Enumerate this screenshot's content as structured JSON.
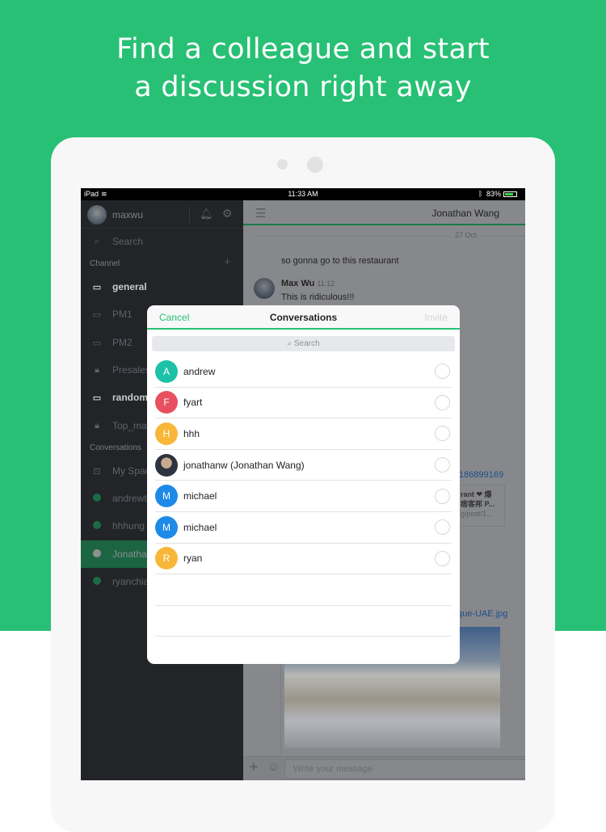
{
  "headline": {
    "line1": "Find a colleague and start",
    "line2": "a discussion right away"
  },
  "colors": {
    "brand": "#27c074"
  },
  "status_bar": {
    "device": "iPad",
    "time": "11:33 AM",
    "battery": "83%"
  },
  "sidebar": {
    "username": "maxwu",
    "search_placeholder": "Search",
    "channel_header": "Channel",
    "conversations_header": "Conversations",
    "channels": [
      {
        "label": "general",
        "icon": "chat-bubble-icon",
        "bold": true
      },
      {
        "label": "PM1",
        "icon": "chat-bubble-icon"
      },
      {
        "label": "PM2",
        "icon": "chat-bubble-icon"
      },
      {
        "label": "Presales",
        "icon": "lock-icon"
      },
      {
        "label": "random",
        "icon": "chat-bubble-icon",
        "bold": true
      },
      {
        "label": "Top_mar",
        "icon": "lock-icon"
      }
    ],
    "conversations": [
      {
        "label": "My Spac",
        "icon": "inbox-icon"
      },
      {
        "label": "andrewt",
        "icon": "online-dot"
      },
      {
        "label": "hhhung",
        "icon": "online-dot"
      },
      {
        "label": "Jonatha",
        "icon": "offline-dot",
        "selected": true
      },
      {
        "label": "ryanchia",
        "icon": "online-dot"
      }
    ]
  },
  "chat": {
    "title": "Jonathan Wang",
    "date_divider": "27 Oct",
    "message1": "so gonna go to this restaurant",
    "sender": "Max Wu",
    "sender_time": "11:12",
    "message2": "This is ridiculous!!!",
    "link_fragment": "186899169",
    "card_title_line1": "rant ❤ 爆",
    "card_title_line2": "痞客邦 P...",
    "card_url": "g/post/1...",
    "image_link": "que-UAE.jpg",
    "input_placeholder": "Write your message"
  },
  "modal": {
    "cancel": "Cancel",
    "title": "Conversations",
    "invite": "Invite",
    "search_placeholder": "Search",
    "contacts": [
      {
        "initial": "A",
        "name": "andrew",
        "color": "#1cc2a6"
      },
      {
        "initial": "F",
        "name": "fyart",
        "color": "#e8505f"
      },
      {
        "initial": "H",
        "name": "hhh",
        "color": "#f8b73a"
      },
      {
        "initial": "",
        "name": "jonathanw (Jonathan Wang)",
        "color": "#3a3f4a"
      },
      {
        "initial": "M",
        "name": "michael",
        "color": "#1d8ae8"
      },
      {
        "initial": "M",
        "name": "michael",
        "color": "#1d8ae8"
      },
      {
        "initial": "R",
        "name": "ryan",
        "color": "#f8b73a"
      }
    ]
  }
}
